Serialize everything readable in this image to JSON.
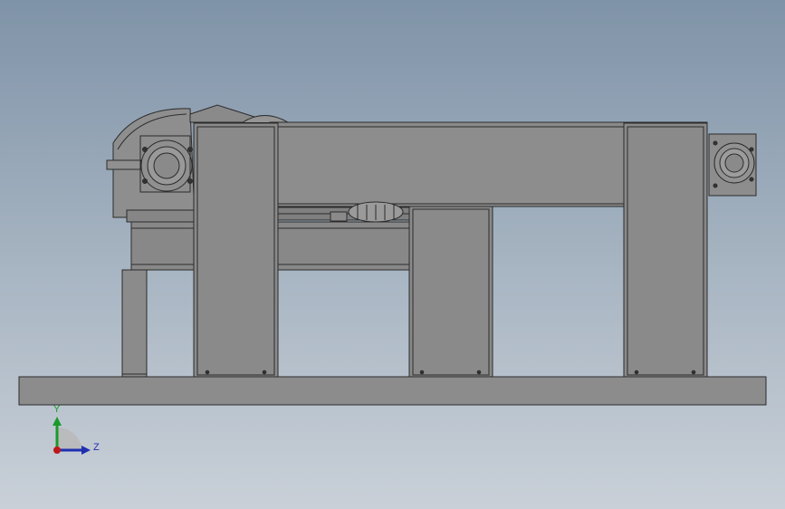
{
  "viewport": {
    "background_top": "#7f93a8",
    "background_bottom": "#c9d0d8"
  },
  "model": {
    "part_color": "#8b8b8b",
    "edge_color": "#2b2b2b",
    "view": "front"
  },
  "triad": {
    "y_label": "Y",
    "z_label": "Z",
    "y_color": "#1a9a2a",
    "z_color": "#1f2fb0",
    "origin_color": "#c01818"
  }
}
